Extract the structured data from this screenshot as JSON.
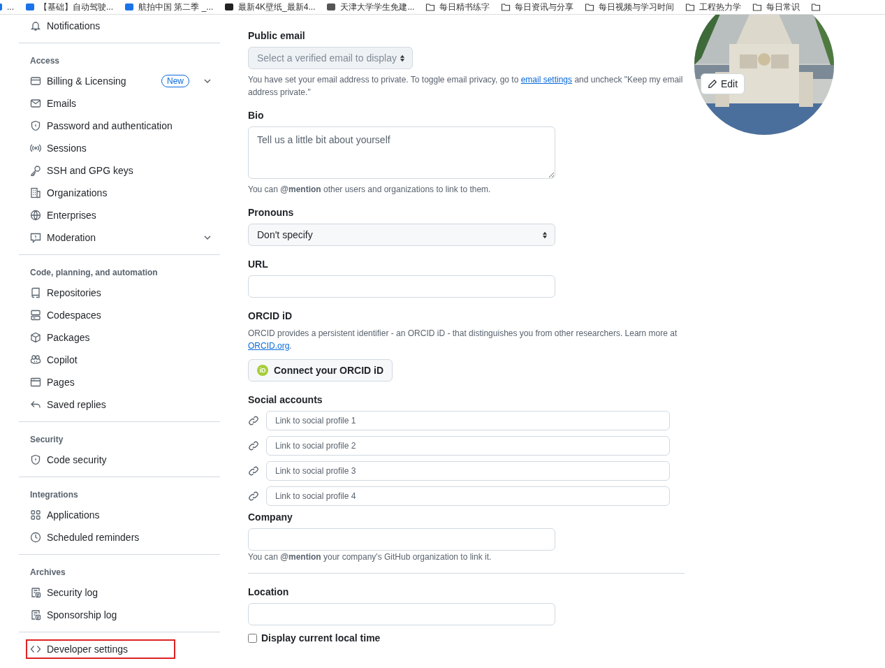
{
  "bookmarks": [
    {
      "kind": "site",
      "label": "...",
      "color": "#1a73e8"
    },
    {
      "kind": "site",
      "label": "【基础】自动驾驶...",
      "color": "#1a73e8"
    },
    {
      "kind": "site",
      "label": "航拍中国 第二季 _...",
      "color": "#1a73e8"
    },
    {
      "kind": "site",
      "label": "最新4K壁纸_最新4...",
      "color": "#222222"
    },
    {
      "kind": "site",
      "label": "天津大学学生免建...",
      "color": "#555555"
    },
    {
      "kind": "folder",
      "label": "每日精书练字"
    },
    {
      "kind": "folder",
      "label": "每日资讯与分享"
    },
    {
      "kind": "folder",
      "label": "每日视频与学习时间"
    },
    {
      "kind": "folder",
      "label": "工程热力学"
    },
    {
      "kind": "folder",
      "label": "每日常识"
    },
    {
      "kind": "folder"
    }
  ],
  "sidebar": {
    "sections": [
      {
        "items": [
          {
            "label": "Notifications"
          }
        ]
      },
      {
        "heading": "Access",
        "items": [
          {
            "label": "Billing & Licensing",
            "badge": "New",
            "expanded": false
          },
          {
            "label": "Emails"
          },
          {
            "label": "Password and authentication"
          },
          {
            "label": "Sessions"
          },
          {
            "label": "SSH and GPG keys"
          },
          {
            "label": "Organizations"
          },
          {
            "label": "Enterprises"
          },
          {
            "label": "Moderation",
            "expanded": false
          }
        ]
      },
      {
        "heading": "Code, planning, and automation",
        "items": [
          {
            "label": "Repositories"
          },
          {
            "label": "Codespaces"
          },
          {
            "label": "Packages"
          },
          {
            "label": "Copilot"
          },
          {
            "label": "Pages"
          },
          {
            "label": "Saved replies"
          }
        ]
      },
      {
        "heading": "Security",
        "items": [
          {
            "label": "Code security"
          }
        ]
      },
      {
        "heading": "Integrations",
        "items": [
          {
            "label": "Applications"
          },
          {
            "label": "Scheduled reminders"
          }
        ]
      },
      {
        "heading": "Archives",
        "items": [
          {
            "label": "Security log"
          },
          {
            "label": "Sponsorship log"
          }
        ]
      },
      {
        "items": [
          {
            "label": "Developer settings",
            "highlighted": true
          }
        ]
      }
    ]
  },
  "form": {
    "public_email": {
      "label": "Public email",
      "placeholder": "Select a verified email to display",
      "disabled": true,
      "note_before": "You have set your email address to private. To toggle email privacy, go to ",
      "note_link": "email settings",
      "note_after": " and uncheck \"Keep my email address private.\""
    },
    "bio": {
      "label": "Bio",
      "placeholder": "Tell us a little bit about yourself",
      "note": "You can **@mention** other users and organizations to link to them."
    },
    "pronouns": {
      "label": "Pronouns",
      "value": "Don't specify"
    },
    "url": {
      "label": "URL"
    },
    "orcid": {
      "label": "ORCID iD",
      "text": "ORCID provides a persistent identifier - an ORCID iD - that distinguishes you from other researchers. Learn more at ",
      "link": "ORCID.org",
      "after": ".",
      "badge": "iD",
      "button": "Connect your ORCID iD"
    },
    "social": {
      "label": "Social accounts",
      "placeholders": [
        "Link to social profile 1",
        "Link to social profile 2",
        "Link to social profile 3",
        "Link to social profile 4"
      ]
    },
    "company": {
      "label": "Company",
      "note": "You can **@mention** your company's GitHub organization to link it."
    },
    "location": {
      "label": "Location"
    },
    "local_time": {
      "label": "Display current local time",
      "checked": false
    }
  },
  "avatar": {
    "kind": "picture",
    "edit": "Edit"
  }
}
